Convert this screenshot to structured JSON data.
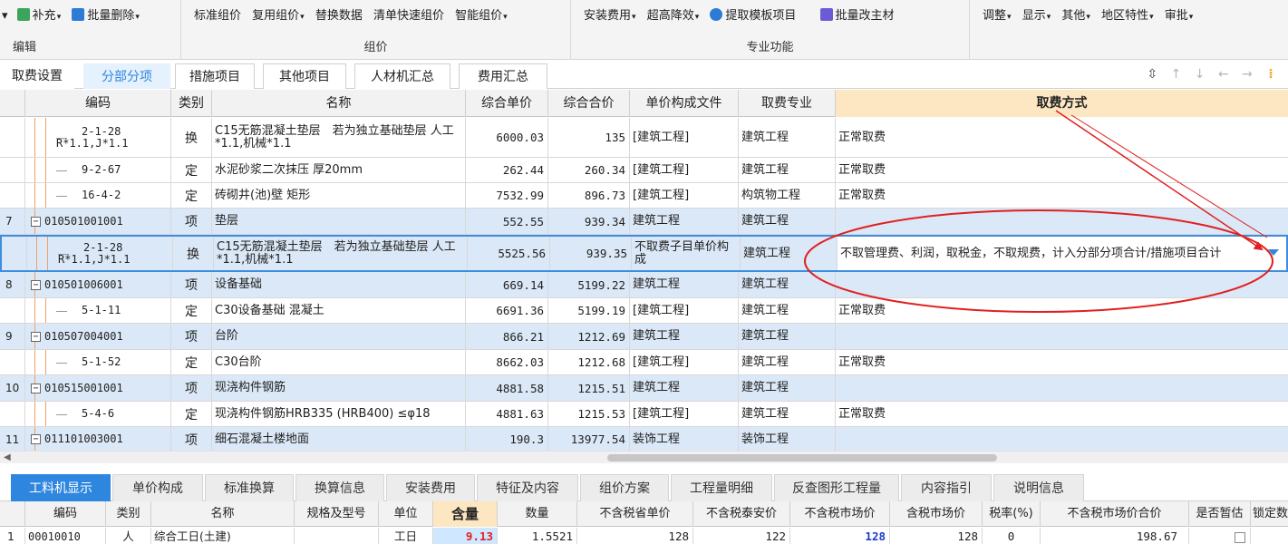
{
  "ribbon": {
    "edit_group": {
      "label": "编辑",
      "buttons": [
        {
          "label": "补充",
          "icon": "supplement-icon"
        },
        {
          "label": "批量删除",
          "icon": "batch-delete-icon"
        }
      ]
    },
    "pricing_group": {
      "label": "组价",
      "buttons": [
        {
          "label": "标准组价"
        },
        {
          "label": "复用组价"
        },
        {
          "label": "替换数据"
        },
        {
          "label": "清单快速组价"
        },
        {
          "label": "智能组价"
        }
      ]
    },
    "special_group": {
      "label": "专业功能",
      "buttons": [
        {
          "label": "安装费用"
        },
        {
          "label": "超高降效"
        },
        {
          "label": "提取模板项目",
          "icon": "extract-template-icon"
        },
        {
          "label": "批量改主材",
          "icon": "batch-material-icon"
        }
      ]
    },
    "right_group": {
      "buttons": [
        {
          "label": "调整"
        },
        {
          "label": "显示"
        },
        {
          "label": "其他"
        },
        {
          "label": "地区特性"
        },
        {
          "label": "审批"
        }
      ]
    }
  },
  "tabs": [
    "取费设置",
    "分部分项",
    "措施项目",
    "其他项目",
    "人材机汇总",
    "费用汇总"
  ],
  "active_tab": "分部分项",
  "grid": {
    "columns": [
      "编码",
      "类别",
      "名称",
      "综合单价",
      "综合合价",
      "单价构成文件",
      "取费专业",
      "取费方式"
    ],
    "rows": [
      {
        "no": "",
        "code": "2-1-28",
        "code2": "R*1.1,J*1.1",
        "type": "换",
        "name": "C15无筋混凝土垫层　若为独立基础垫层 人工*1.1,机械*1.1",
        "unit_price": "6000.03",
        "total": "135",
        "file": "[建筑工程]",
        "major": "建筑工程",
        "method": "正常取费",
        "kind": "sub"
      },
      {
        "no": "",
        "code": "9-2-67",
        "type": "定",
        "name": "水泥砂浆二次抹压 厚20mm",
        "unit_price": "262.44",
        "total": "260.34",
        "file": "[建筑工程]",
        "major": "建筑工程",
        "method": "正常取费",
        "kind": "sub"
      },
      {
        "no": "",
        "code": "16-4-2",
        "type": "定",
        "name": "砖砌井(池)壁 矩形",
        "unit_price": "7532.99",
        "total": "896.73",
        "file": "[建筑工程]",
        "major": "构筑物工程",
        "method": "正常取费",
        "kind": "sub"
      },
      {
        "no": "7",
        "code": "010501001001",
        "type": "项",
        "name": "垫层",
        "unit_price": "552.55",
        "total": "939.34",
        "file": "建筑工程",
        "major": "建筑工程",
        "method": "",
        "kind": "item"
      },
      {
        "no": "",
        "code": "2-1-28",
        "code2": "R*1.1,J*1.1",
        "type": "换",
        "name": "C15无筋混凝土垫层　若为独立基础垫层 人工*1.1,机械*1.1",
        "unit_price": "5525.56",
        "total": "939.35",
        "file": "不取费子目单价构成",
        "major": "建筑工程",
        "method": "不取管理费、利润，取税金，不取规费，计入分部分项合计/措施项目合计",
        "kind": "selected"
      },
      {
        "no": "8",
        "code": "010501006001",
        "type": "项",
        "name": "设备基础",
        "unit_price": "669.14",
        "total": "5199.22",
        "file": "建筑工程",
        "major": "建筑工程",
        "method": "",
        "kind": "item"
      },
      {
        "no": "",
        "code": "5-1-11",
        "type": "定",
        "name": "C30设备基础 混凝土",
        "unit_price": "6691.36",
        "total": "5199.19",
        "file": "[建筑工程]",
        "major": "建筑工程",
        "method": "正常取费",
        "kind": "sub"
      },
      {
        "no": "9",
        "code": "010507004001",
        "type": "项",
        "name": "台阶",
        "unit_price": "866.21",
        "total": "1212.69",
        "file": "建筑工程",
        "major": "建筑工程",
        "method": "",
        "kind": "item"
      },
      {
        "no": "",
        "code": "5-1-52",
        "type": "定",
        "name": "C30台阶",
        "unit_price": "8662.03",
        "total": "1212.68",
        "file": "[建筑工程]",
        "major": "建筑工程",
        "method": "正常取费",
        "kind": "sub"
      },
      {
        "no": "10",
        "code": "010515001001",
        "type": "项",
        "name": "现浇构件钢筋",
        "unit_price": "4881.58",
        "total": "1215.51",
        "file": "建筑工程",
        "major": "建筑工程",
        "method": "",
        "kind": "item"
      },
      {
        "no": "",
        "code": "5-4-6",
        "type": "定",
        "name": "现浇构件钢筋HRB335 (HRB400) ≤φ18",
        "unit_price": "4881.63",
        "total": "1215.53",
        "file": "[建筑工程]",
        "major": "建筑工程",
        "method": "正常取费",
        "kind": "sub"
      },
      {
        "no": "11",
        "code": "011101003001",
        "type": "项",
        "name": "细石混凝土楼地面",
        "unit_price": "190.3",
        "total": "13977.54",
        "file": "装饰工程",
        "major": "装饰工程",
        "method": "",
        "kind": "item"
      }
    ]
  },
  "bottom_tabs": [
    "工料机显示",
    "单价构成",
    "标准换算",
    "换算信息",
    "安装费用",
    "特征及内容",
    "组价方案",
    "工程量明细",
    "反查图形工程量",
    "内容指引",
    "说明信息"
  ],
  "active_bottom_tab": "工料机显示",
  "bottom_grid": {
    "columns": [
      "编码",
      "类别",
      "名称",
      "规格及型号",
      "单位",
      "含量",
      "数量",
      "不含税省单价",
      "不含税泰安价",
      "不含税市场价",
      "含税市场价",
      "税率(%)",
      "不含税市场价合价",
      "是否暂估",
      "锁定数"
    ],
    "rows": [
      {
        "no": "1",
        "code": "00010010",
        "type": "人",
        "name": "综合工日(土建)",
        "spec": "",
        "unit": "工日",
        "content": "9.13",
        "qty": "1.5521",
        "prov_price": "128",
        "taian_price": "122",
        "market_price": "128",
        "tax_market": "128",
        "tax_rate": "0",
        "market_total": "198.67"
      }
    ]
  },
  "colors": {
    "accent": "#2e86de",
    "annotation": "#e02020",
    "item_row": "#dbe8f7",
    "header_highlight": "#fde6c2"
  }
}
